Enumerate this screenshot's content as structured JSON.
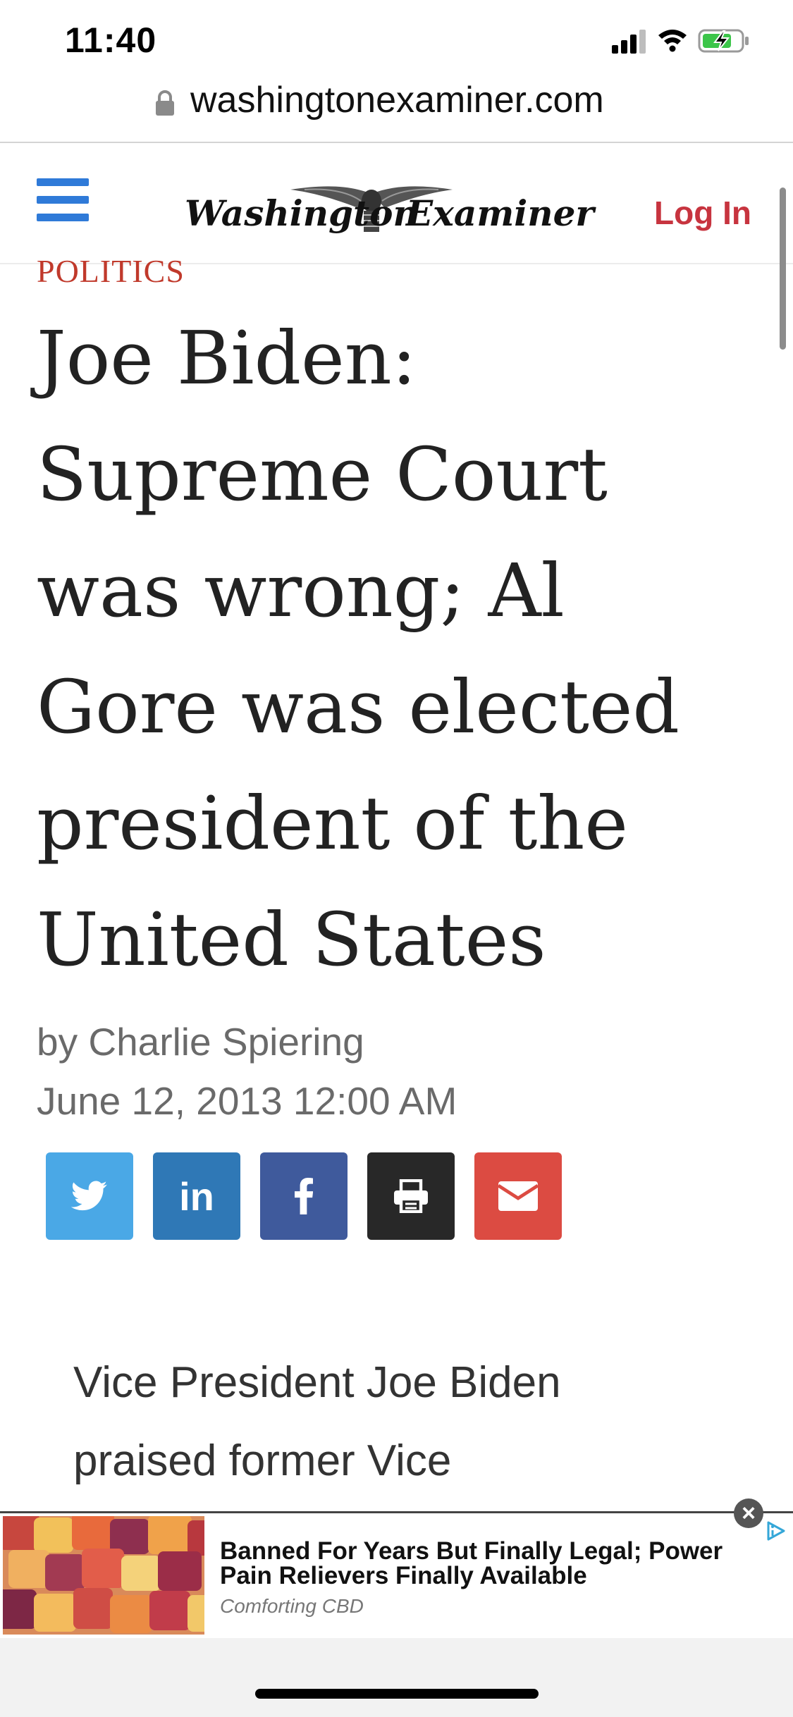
{
  "status_bar": {
    "time": "11:40",
    "icons": [
      "cellular-signal-icon",
      "wifi-icon",
      "battery-charging-icon"
    ]
  },
  "browser": {
    "url": "washingtonexaminer.com"
  },
  "site_header": {
    "logo_text_left": "Washington",
    "logo_text_right": "Examiner",
    "login_label": "Log In",
    "menu_icon": "hamburger-menu-icon",
    "accent_color": "#c7343f",
    "menu_color": "#2f7ad8"
  },
  "article": {
    "section": "POLITICS",
    "headline_lines": [
      "Joe Biden:",
      "Supreme Court",
      "was wrong; Al",
      "Gore was elected",
      "president of the",
      "United States"
    ],
    "byline": "by Charlie Spiering",
    "date": "June 12, 2013 12:00 AM",
    "body_lines": [
      "Vice President Joe Biden",
      "praised former Vice"
    ]
  },
  "share_buttons": [
    {
      "name": "twitter",
      "icon": "twitter-icon",
      "color": "#4aa8e6"
    },
    {
      "name": "linkedin",
      "icon": "linkedin-icon",
      "label": "in",
      "color": "#2f78b6"
    },
    {
      "name": "facebook",
      "icon": "facebook-icon",
      "color": "#3f5a9c"
    },
    {
      "name": "print",
      "icon": "print-icon",
      "color": "#282828"
    },
    {
      "name": "email",
      "icon": "email-icon",
      "color": "#dc4b42"
    }
  ],
  "ad": {
    "title": "Banned For Years But Finally Legal; Power Pain Relievers Finally Available",
    "source": "Comforting CBD",
    "close_icon": "close-icon",
    "adchoices_icon": "adchoices-icon"
  }
}
